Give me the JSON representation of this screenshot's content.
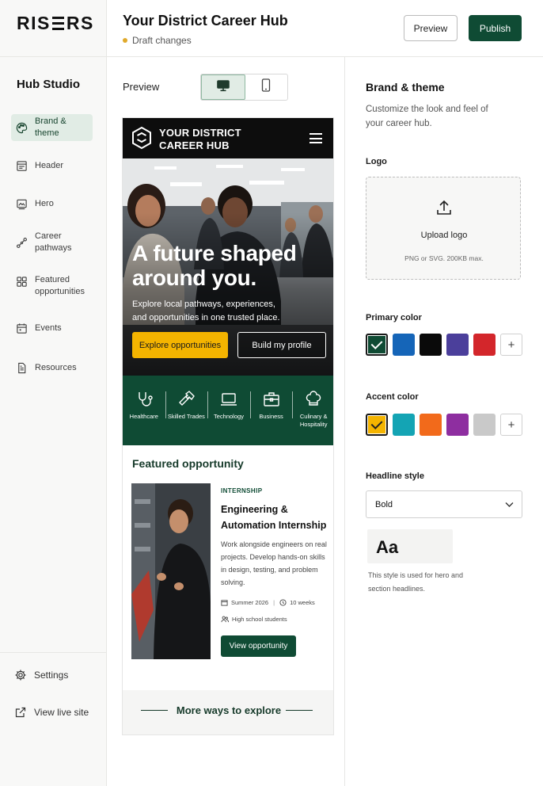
{
  "brand": {
    "logo_text_1": "RIS",
    "logo_text_2": "RS"
  },
  "sidebar": {
    "title": "Hub Studio",
    "items": [
      {
        "label": "Brand & theme",
        "icon": "palette-icon",
        "active": true
      },
      {
        "label": "Header",
        "icon": "header-icon"
      },
      {
        "label": "Hero",
        "icon": "hero-image-icon"
      },
      {
        "label": "Career pathways",
        "icon": "pathways-icon"
      },
      {
        "label": "Featured opportunities",
        "icon": "grid-icon"
      },
      {
        "label": "Events",
        "icon": "calendar-icon"
      },
      {
        "label": "Resources",
        "icon": "document-icon"
      }
    ],
    "footer": {
      "settings": "Settings",
      "view_live": "View live site"
    }
  },
  "topbar": {
    "title": "Your District Career Hub",
    "status": "Draft changes",
    "preview_button": "Preview",
    "publish_button": "Publish"
  },
  "preview": {
    "label": "Preview",
    "device": "desktop"
  },
  "phone": {
    "site_title_1": "YOUR DISTRICT",
    "site_title_2": "CAREER HUB",
    "hero_line_1": "A future shaped",
    "hero_line_2": "around you.",
    "hero_sub": "Explore local pathways, experiences, and opportunities in one trusted place.",
    "hero_btn_primary": "Explore opportunities",
    "hero_btn_secondary": "Build my profile",
    "pathways": [
      {
        "label": "Healthcare",
        "icon": "stethoscope-icon"
      },
      {
        "label": "Skilled Trades",
        "icon": "hammer-icon"
      },
      {
        "label": "Technology",
        "icon": "laptop-icon"
      },
      {
        "label": "Business",
        "icon": "briefcase-icon"
      },
      {
        "label": "Culinary & Hospitality",
        "icon": "chef-hat-icon"
      }
    ],
    "featured": {
      "section_title": "Featured opportunity",
      "tag": "INTERNSHIP",
      "title": "Engineering & Automation Internship",
      "description": "Work alongside engineers on real projects. Develop hands-on skills in design, testing, and problem solving.",
      "date": "Summer 2026",
      "duration": "10 weeks",
      "audience": "High school students",
      "button": "View opportunity"
    },
    "more": "More ways to explore"
  },
  "panel": {
    "title": "Brand & theme",
    "description": "Customize the look and feel of your career hub.",
    "logo_label": "Logo",
    "upload_label": "Upload logo",
    "upload_hint": "PNG or SVG. 200KB max.",
    "primary_label": "Primary color",
    "primary_colors": [
      "#0f4b34",
      "#1565b8",
      "#0a0a0a",
      "#4b3f9b",
      "#d3262b"
    ],
    "accent_label": "Accent color",
    "accent_colors": [
      "#f4b400",
      "#14a4b4",
      "#f26a1b",
      "#8e2ea0",
      "#c9c9c9"
    ],
    "headline_label": "Headline style",
    "headline_value": "Bold",
    "sample": "Aa",
    "sample_desc": "This style is used for hero and section headlines."
  }
}
